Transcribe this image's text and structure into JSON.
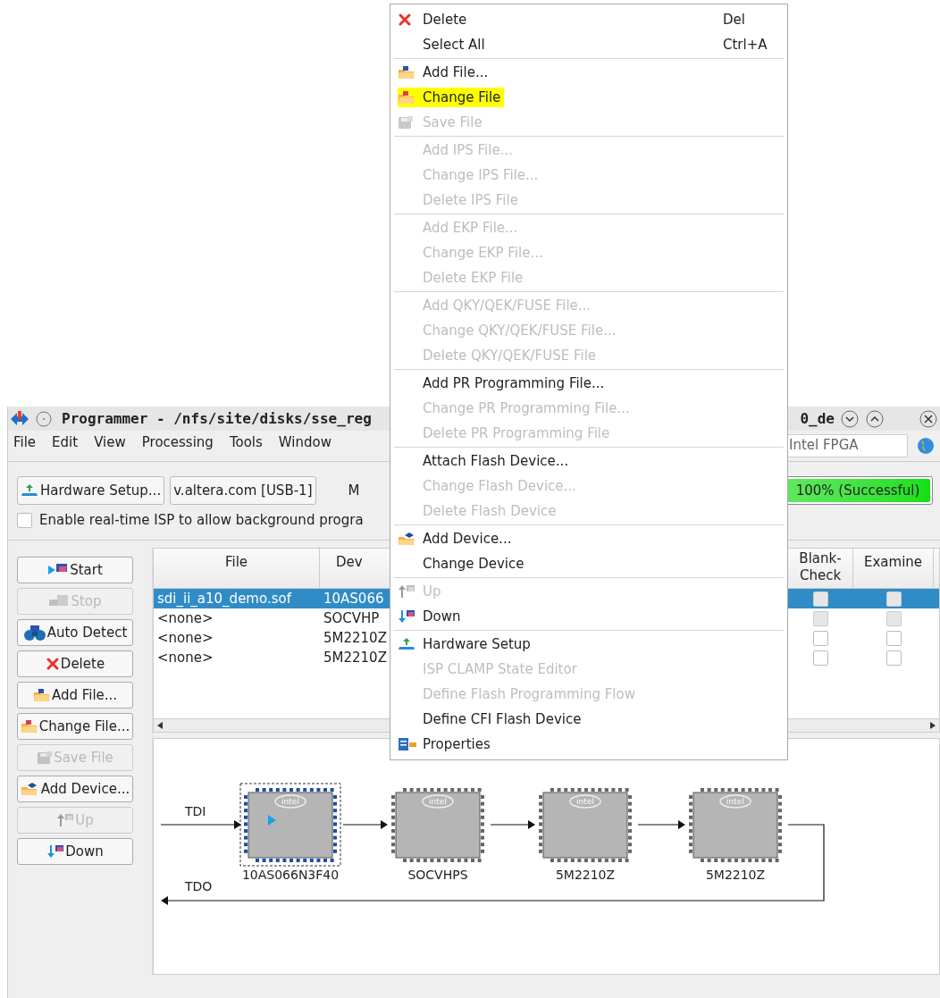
{
  "window": {
    "title_left": "Programmer - /nfs/site/disks/sse_reg",
    "title_right": "0_de"
  },
  "menubar": [
    "File",
    "Edit",
    "View",
    "Processing",
    "Tools",
    "Window"
  ],
  "search": {
    "value": "Intel FPGA"
  },
  "toolbar": {
    "hardware_button": "Hardware Setup...",
    "hardware_field": "v.altera.com [USB-1]",
    "mode_label": "M",
    "progress": {
      "text": "100% (Successful)",
      "level": 1
    }
  },
  "realtime_isp": {
    "label": "Enable real-time ISP to allow background progra",
    "checked": false
  },
  "side_buttons": [
    {
      "label": "Start",
      "disabled": false
    },
    {
      "label": "Stop",
      "disabled": true
    },
    {
      "label": "Auto Detect",
      "disabled": false
    },
    {
      "label": "Delete",
      "disabled": false
    },
    {
      "label": "Add File...",
      "disabled": false
    },
    {
      "label": "Change File...",
      "disabled": false
    },
    {
      "label": "Save File",
      "disabled": true
    },
    {
      "label": "Add Device...",
      "disabled": false
    },
    {
      "label": "Up",
      "disabled": true
    },
    {
      "label": "Down",
      "disabled": false
    }
  ],
  "table": {
    "columns": [
      "File",
      "Dev",
      "Blank-\nCheck",
      "Examine"
    ],
    "rows": [
      {
        "file": "sdi_ii_a10_demo.sof",
        "device": "10AS066",
        "selected": true,
        "blank_check": {
          "checked": false,
          "disabled": true
        },
        "examine": {
          "checked": false,
          "disabled": true
        }
      },
      {
        "file": "<none>",
        "device": "SOCVHP",
        "selected": false,
        "blank_check": {
          "checked": false,
          "disabled": true
        },
        "examine": {
          "checked": false,
          "disabled": true
        }
      },
      {
        "file": "<none>",
        "device": "5M2210Z",
        "selected": false,
        "blank_check": {
          "checked": false,
          "disabled": false
        },
        "examine": {
          "checked": false,
          "disabled": false
        }
      },
      {
        "file": "<none>",
        "device": "5M2210Z",
        "selected": false,
        "blank_check": {
          "checked": false,
          "disabled": false
        },
        "examine": {
          "checked": false,
          "disabled": false
        }
      }
    ]
  },
  "chain": {
    "tdi": "TDI",
    "tdo": "TDO",
    "devices": [
      {
        "name": "10AS066N3F40",
        "logo": "intel",
        "selected": true
      },
      {
        "name": "SOCVHPS",
        "logo": "intel",
        "selected": false
      },
      {
        "name": "5M2210Z",
        "logo": "intel",
        "selected": false
      },
      {
        "name": "5M2210Z",
        "logo": "intel",
        "selected": false
      }
    ]
  },
  "context_menu": [
    {
      "kind": "item",
      "label": "Delete",
      "shortcut": "Del",
      "disabled": false,
      "highlighted": false
    },
    {
      "kind": "item",
      "label": "Select All",
      "shortcut": "Ctrl+A",
      "disabled": false,
      "highlighted": false
    },
    {
      "kind": "separator"
    },
    {
      "kind": "item",
      "label": "Add File...",
      "disabled": false,
      "highlighted": false
    },
    {
      "kind": "item",
      "label": "Change File",
      "disabled": false,
      "highlighted": true
    },
    {
      "kind": "item",
      "label": "Save File",
      "disabled": true,
      "highlighted": false
    },
    {
      "kind": "separator"
    },
    {
      "kind": "item",
      "label": "Add IPS File...",
      "disabled": true,
      "highlighted": false
    },
    {
      "kind": "item",
      "label": "Change IPS File...",
      "disabled": true,
      "highlighted": false
    },
    {
      "kind": "item",
      "label": "Delete IPS File",
      "disabled": true,
      "highlighted": false
    },
    {
      "kind": "separator"
    },
    {
      "kind": "item",
      "label": "Add EKP File...",
      "disabled": true,
      "highlighted": false
    },
    {
      "kind": "item",
      "label": "Change EKP File...",
      "disabled": true,
      "highlighted": false
    },
    {
      "kind": "item",
      "label": "Delete EKP File",
      "disabled": true,
      "highlighted": false
    },
    {
      "kind": "separator"
    },
    {
      "kind": "item",
      "label": "Add QKY/QEK/FUSE File...",
      "disabled": true,
      "highlighted": false
    },
    {
      "kind": "item",
      "label": "Change QKY/QEK/FUSE File...",
      "disabled": true,
      "highlighted": false
    },
    {
      "kind": "item",
      "label": "Delete QKY/QEK/FUSE File",
      "disabled": true,
      "highlighted": false
    },
    {
      "kind": "separator"
    },
    {
      "kind": "item",
      "label": "Add PR Programming File...",
      "disabled": false,
      "highlighted": false
    },
    {
      "kind": "item",
      "label": "Change PR Programming File...",
      "disabled": true,
      "highlighted": false
    },
    {
      "kind": "item",
      "label": "Delete PR Programming File",
      "disabled": true,
      "highlighted": false
    },
    {
      "kind": "separator"
    },
    {
      "kind": "item",
      "label": "Attach Flash Device...",
      "disabled": false,
      "highlighted": false
    },
    {
      "kind": "item",
      "label": "Change Flash Device...",
      "disabled": true,
      "highlighted": false
    },
    {
      "kind": "item",
      "label": "Delete Flash Device",
      "disabled": true,
      "highlighted": false
    },
    {
      "kind": "separator"
    },
    {
      "kind": "item",
      "label": "Add Device...",
      "disabled": false,
      "highlighted": false
    },
    {
      "kind": "item",
      "label": "Change Device",
      "disabled": false,
      "highlighted": false
    },
    {
      "kind": "separator"
    },
    {
      "kind": "item",
      "label": "Up",
      "disabled": true,
      "highlighted": false
    },
    {
      "kind": "item",
      "label": "Down",
      "disabled": false,
      "highlighted": false
    },
    {
      "kind": "separator"
    },
    {
      "kind": "item",
      "label": "Hardware Setup",
      "disabled": false,
      "highlighted": false
    },
    {
      "kind": "item",
      "label": "ISP CLAMP State Editor",
      "disabled": true,
      "highlighted": false
    },
    {
      "kind": "item",
      "label": "Define Flash Programming Flow",
      "disabled": true,
      "highlighted": false
    },
    {
      "kind": "item",
      "label": "Define CFI Flash Device",
      "disabled": false,
      "highlighted": false
    },
    {
      "kind": "item",
      "label": "Properties",
      "disabled": false,
      "highlighted": false
    }
  ]
}
